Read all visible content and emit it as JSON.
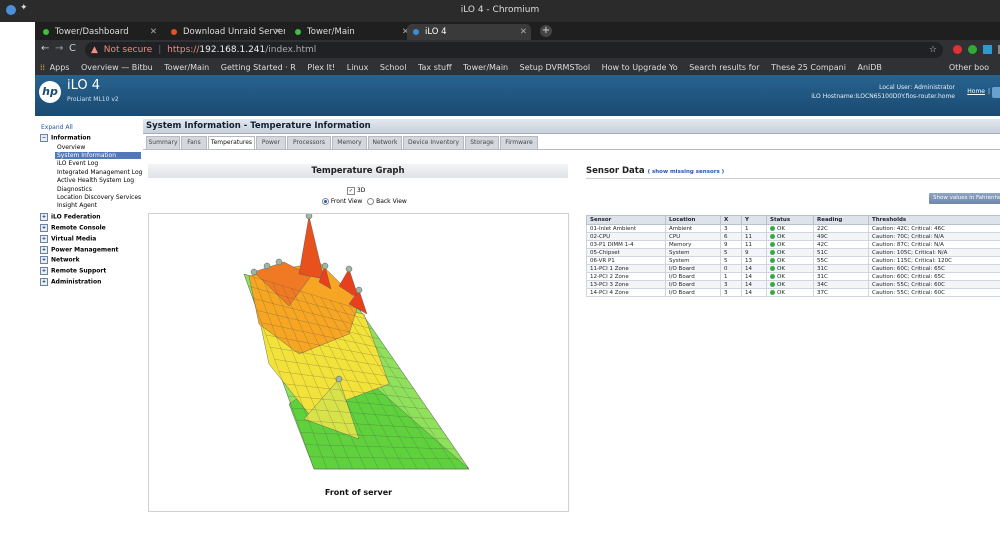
{
  "os": {
    "window_title": "iLO 4 - Chromium"
  },
  "browser": {
    "tabs": [
      {
        "label": "Tower/Dashboard"
      },
      {
        "label": "Download Unraid Server OS"
      },
      {
        "label": "Tower/Main"
      },
      {
        "label": "iLO 4"
      }
    ],
    "security_label": "Not secure",
    "url_https": "https://",
    "url_host": "192.168.1.241",
    "url_path": "/index.html",
    "bookmarks": [
      "Apps",
      "Overview — Bitbu",
      "Tower/Main",
      "Getting Started · R",
      "Plex It!",
      "Linux",
      "School",
      "Tax stuff",
      "Tower/Main",
      "Setup DVRMSTool",
      "How to Upgrade Yo",
      "Search results for",
      "These 25 Compani",
      "AniDB"
    ],
    "other_bookmarks": "Other boo"
  },
  "ilo": {
    "logo_text": "hp",
    "product_name": "iLO 4",
    "product_model": "ProLiant ML10 v2",
    "local_user": "Local User:  Administrator",
    "hostname": "iLO Hostname:ILOCN65100D0Y.fios-router.home",
    "home_link": "Home",
    "separator": "|"
  },
  "sidebar": {
    "expand_all": "Expand All",
    "information": {
      "label": "Information",
      "items": [
        "Overview",
        "System Information",
        "iLO Event Log",
        "Integrated Management Log",
        "Active Health System Log",
        "Diagnostics",
        "Location Discovery Services",
        "Insight Agent"
      ]
    },
    "sections": [
      "iLO Federation",
      "Remote Console",
      "Virtual Media",
      "Power Management",
      "Network",
      "Remote Support",
      "Administration"
    ]
  },
  "main": {
    "section_title": "System Information - Temperature Information",
    "tabs": [
      "Summary",
      "Fans",
      "Temperatures",
      "Power",
      "Processors",
      "Memory",
      "Network",
      "Device Inventory",
      "Storage",
      "Firmware"
    ]
  },
  "graph": {
    "title": "Temperature Graph",
    "checkbox_3d": "3D",
    "front_view": "Front View",
    "back_view": "Back View",
    "caption": "Front of server",
    "colors": {
      "hot": "#e8401c",
      "warm": "#f6a623",
      "mid": "#f3e23a",
      "cool": "#5fd13d"
    }
  },
  "sensor": {
    "title": "Sensor Data",
    "link": "( show missing sensors )",
    "fahrenheit_button": "Show values in Fahrenheit",
    "headers": [
      "Sensor",
      "Location",
      "X",
      "Y",
      "Status",
      "Reading",
      "Thresholds"
    ],
    "rows": [
      [
        "01-Inlet Ambient",
        "Ambient",
        "3",
        "1",
        "OK",
        "22C",
        "Caution: 42C; Critical: 46C"
      ],
      [
        "02-CPU",
        "CPU",
        "6",
        "11",
        "OK",
        "49C",
        "Caution: 70C; Critical: N/A"
      ],
      [
        "03-P1 DIMM 1-4",
        "Memory",
        "9",
        "11",
        "OK",
        "42C",
        "Caution: 87C; Critical: N/A"
      ],
      [
        "05-Chipset",
        "System",
        "5",
        "9",
        "OK",
        "51C",
        "Caution: 105C; Critical: N/A"
      ],
      [
        "06-VR P1",
        "System",
        "5",
        "13",
        "OK",
        "55C",
        "Caution: 115C; Critical: 120C"
      ],
      [
        "11-PCI 1 Zone",
        "I/O Board",
        "0",
        "14",
        "OK",
        "31C",
        "Caution: 60C; Critical: 65C"
      ],
      [
        "12-PCI 2 Zone",
        "I/O Board",
        "1",
        "14",
        "OK",
        "31C",
        "Caution: 60C; Critical: 65C"
      ],
      [
        "13-PCI 3 Zone",
        "I/O Board",
        "3",
        "14",
        "OK",
        "34C",
        "Caution: 55C; Critical: 60C"
      ],
      [
        "14-PCI 4 Zone",
        "I/O Board",
        "3",
        "14",
        "OK",
        "37C",
        "Caution: 55C; Critical: 60C"
      ]
    ]
  }
}
